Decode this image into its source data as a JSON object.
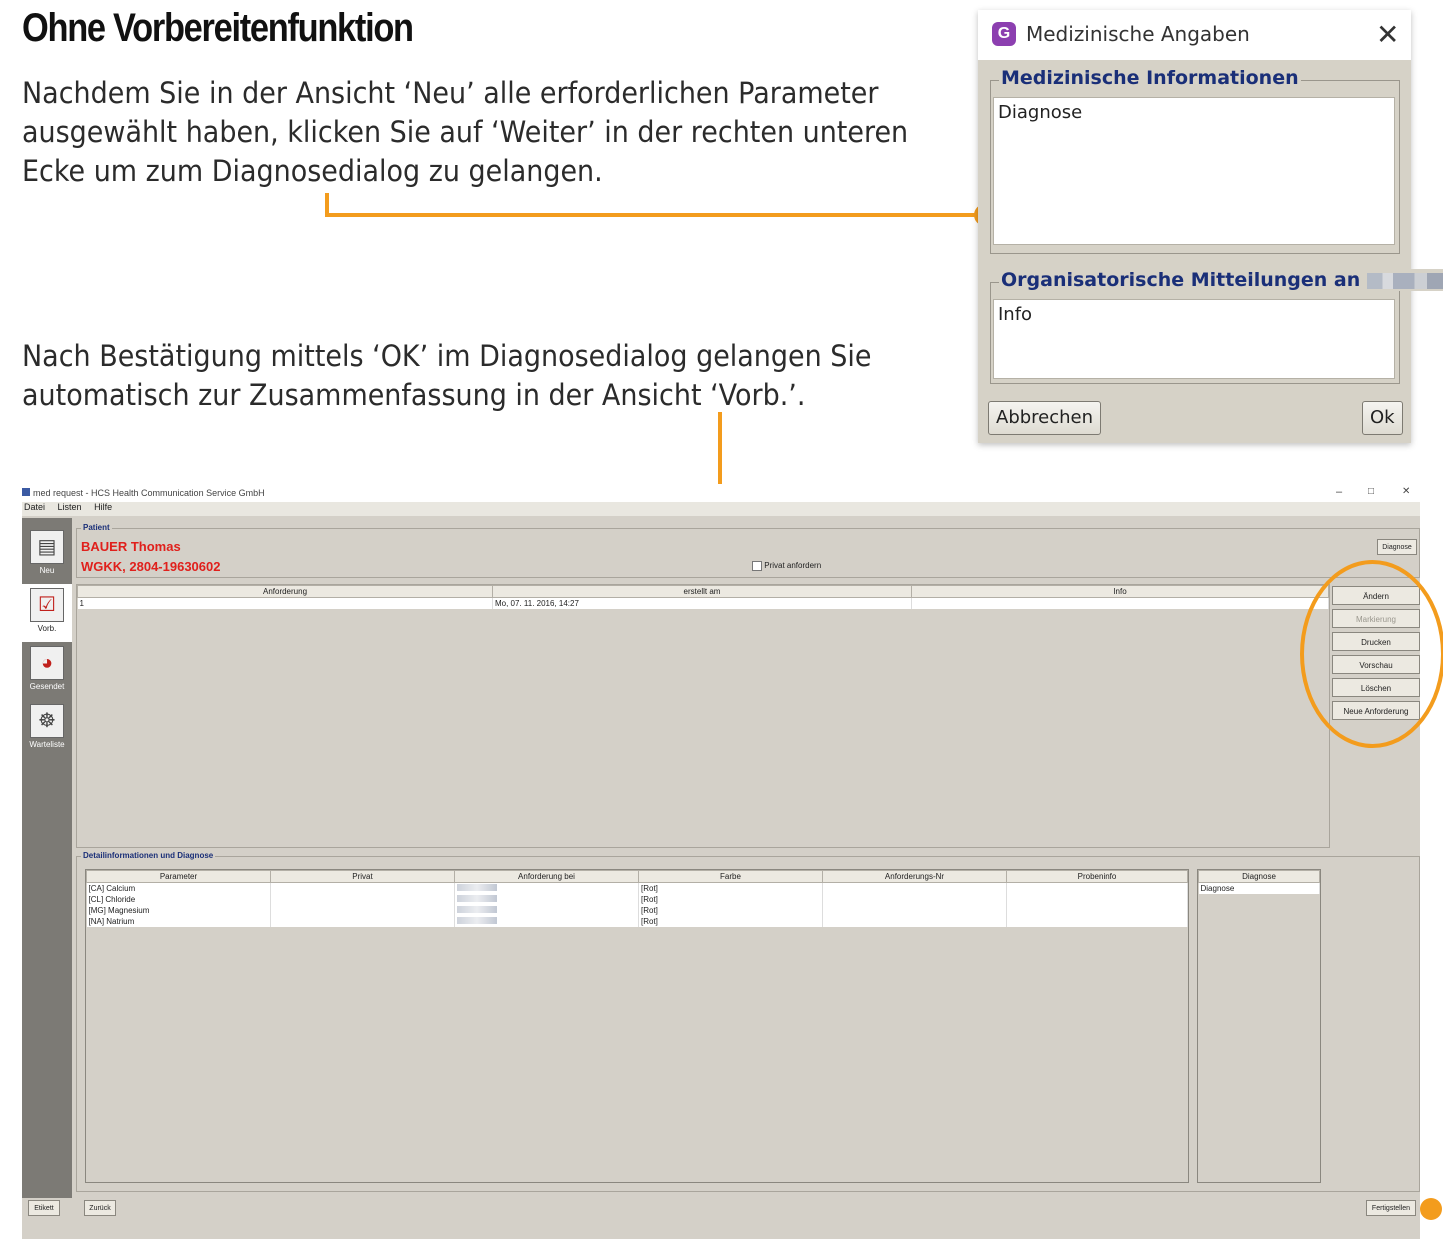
{
  "doc": {
    "heading": "Ohne Vorbereitenfunktion",
    "para1": [
      "Nachdem Sie in der Ansicht ‘Neu’ alle erforderlichen Parameter",
      "ausgewählt haben, klicken Sie auf ‘Weiter’ in der rechten unteren",
      "Ecke um zum Diagnosedialog zu gelangen."
    ],
    "para2": [
      "Nach Bestätigung mittels ‘OK’ im Diagnosedialog gelangen Sie",
      "automatisch zur Zusammenfassung in der Ansicht ‘Vorb.’."
    ]
  },
  "dialog": {
    "icon_letter": "G",
    "title": "Medizinische Angaben",
    "close": "✕",
    "med_legend": "Medizinische Informationen",
    "diagnose_text": "Diagnose",
    "org_legend": "Organisatorische Mitteilungen an",
    "info_text": "Info",
    "cancel_label": "Abbrechen",
    "ok_label": "Ok",
    "accent_color": "#1a2f78",
    "icon_color": "#8c3fb0"
  },
  "app": {
    "title": "med request - HCS Health Communication Service GmbH",
    "window_controls": [
      "–",
      "□",
      "✕"
    ],
    "menu": [
      "Datei",
      "Listen",
      "Hilfe"
    ],
    "nav": [
      {
        "label": "Neu",
        "icon": "new-document-icon"
      },
      {
        "label": "Vorb.",
        "icon": "checklist-icon"
      },
      {
        "label": "Gesendet",
        "icon": "chart-sent-icon"
      },
      {
        "label": "Warteliste",
        "icon": "waiting-list-icon"
      }
    ],
    "patient_legend": "Patient",
    "patient_name": "BAUER Thomas",
    "patient_ins": "WGKK, 2804-19630602",
    "privat_label": "Privat anfordern",
    "diag_btn": "Diagnose",
    "req_table": {
      "headers": [
        "Anforderung",
        "erstellt am",
        "Info"
      ],
      "rows": [
        [
          "1",
          "Mo, 07. 11. 2016, 14:27",
          ""
        ]
      ]
    },
    "side_buttons": [
      {
        "label": "Ändern",
        "enabled": true
      },
      {
        "label": "Markierung",
        "enabled": false
      },
      {
        "label": "Drucken",
        "enabled": true
      },
      {
        "label": "Vorschau",
        "enabled": true
      },
      {
        "label": "Löschen",
        "enabled": true
      },
      {
        "label": "Neue Anforderung",
        "enabled": true
      }
    ],
    "detail_legend": "Detailinformationen und Diagnose",
    "detail_table": {
      "headers": [
        "Parameter",
        "Privat",
        "Anforderung bei",
        "Farbe",
        "Anforderungs-Nr",
        "Probeninfo"
      ],
      "rows": [
        [
          "[CA] Calcium",
          "",
          "",
          "[Rot]",
          "",
          ""
        ],
        [
          "[CL] Chloride",
          "",
          "",
          "[Rot]",
          "",
          ""
        ],
        [
          "[MG] Magnesium",
          "",
          "",
          "[Rot]",
          "",
          ""
        ],
        [
          "[NA] Natrium",
          "",
          "",
          "[Rot]",
          "",
          ""
        ]
      ]
    },
    "diag_table": {
      "header": "Diagnose",
      "value": "Diagnose"
    },
    "bottom": {
      "etikett": "Etikett",
      "zurueck": "Zurück",
      "fertig": "Fertigstellen"
    },
    "patient_color": "#e0201c",
    "callout_color": "#f39c1d"
  }
}
